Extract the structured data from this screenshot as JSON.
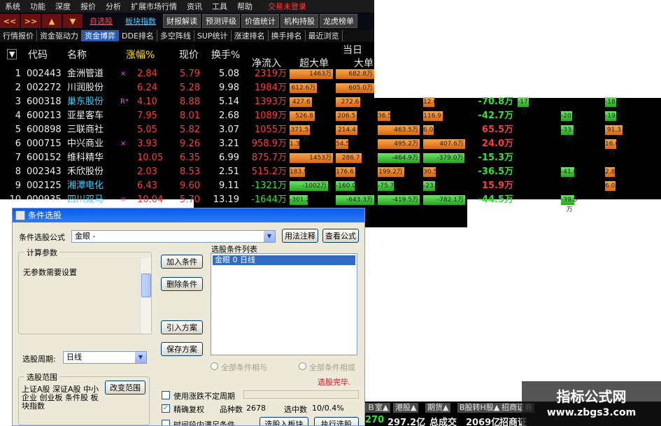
{
  "menubar": {
    "items": [
      "系统",
      "功能",
      "深度",
      "报价",
      "分析",
      "扩展市场行情",
      "资讯",
      "工具",
      "帮助"
    ],
    "trade_login": "交易未登录"
  },
  "toolbar": {
    "nav_buttons": [
      "<<",
      ">>"
    ],
    "link_buttons": [
      "自选股",
      "板块指数"
    ],
    "gray_buttons": [
      "财报解读",
      "预测评级",
      "价值统计",
      "机构持股",
      "龙虎榜单"
    ]
  },
  "subtabs": {
    "items": [
      "行情报价",
      "资金驱动力",
      "资金博弈",
      "DDE排名",
      "多空阵线",
      "SUP统计",
      "涨速排名",
      "换手排名",
      "最近浏览"
    ],
    "active": "资金博弈"
  },
  "table": {
    "headers": [
      "代码",
      "名称",
      "涨幅%",
      "现价",
      "换手%",
      "净流入",
      "超大单",
      "大单"
    ],
    "today_label": "当日",
    "rows": [
      {
        "idx": "1",
        "code": "002443",
        "name": "金洲管道",
        "mark": "×",
        "pct": "2.84",
        "price": "5.79",
        "turnover": "5.08",
        "net": "2319万",
        "huge": "1463万",
        "large": "682.8万"
      },
      {
        "idx": "2",
        "code": "002272",
        "name": "川润股份",
        "mark": "",
        "pct": "6.24",
        "price": "5.28",
        "turnover": "9.98",
        "net": "1984万",
        "huge": "612.6万",
        "large": "605.0万"
      },
      {
        "idx": "3",
        "code": "600318",
        "name": "巢东股份",
        "mark": "R*",
        "pct": "4.10",
        "price": "8.88",
        "turnover": "5.14",
        "net": "1393万",
        "huge": "427.6万",
        "large": "272.6万"
      },
      {
        "idx": "4",
        "code": "600213",
        "name": "亚星客车",
        "mark": "",
        "pct": "7.95",
        "price": "8.01",
        "turnover": "2.68",
        "net": "1089万",
        "huge": "526.8万",
        "large": "206.5万"
      },
      {
        "idx": "5",
        "code": "600898",
        "name": "三联商社",
        "mark": "",
        "pct": "5.05",
        "price": "5.82",
        "turnover": "3.07",
        "net": "1055万",
        "huge": "371.5万",
        "large": "214.4万"
      },
      {
        "idx": "6",
        "code": "000715",
        "name": "中兴商业",
        "mark": "×",
        "pct": "3.93",
        "price": "9.26",
        "turnover": "3.21",
        "net": "958.9万",
        "huge": "1.3万",
        "large": "54.5万"
      },
      {
        "idx": "7",
        "code": "600152",
        "name": "维科精华",
        "mark": "",
        "pct": "10.05",
        "price": "6.35",
        "turnover": "6.99",
        "net": "875.7万",
        "huge": "1453万",
        "large": "286.7万"
      },
      {
        "idx": "8",
        "code": "002343",
        "name": "禾欣股份",
        "mark": "",
        "pct": "2.03",
        "price": "8.53",
        "turnover": "2.51",
        "net": "515.2万",
        "huge": "183.9万",
        "large": "176.6万"
      },
      {
        "idx": "9",
        "code": "002125",
        "name": "湘潭电化",
        "mark": "",
        "pct": "6.43",
        "price": "9.60",
        "turnover": "9.11",
        "net": "-1321万",
        "huge": "-1002万",
        "large": "-160.0万"
      },
      {
        "idx": "10",
        "code": "000935",
        "name": "四川双马",
        "mark": "×",
        "pct": "10.04",
        "price": "5.70",
        "turnover": "13.19",
        "net": "-1644万",
        "huge": "-301.2万",
        "large": "-643.3万"
      }
    ],
    "extra_cols": [
      {
        "c1": "",
        "c2": "12.6万",
        "v1": "-70.8万",
        "v2": "-17.0万",
        "v3": "",
        "v4": "-18.6万"
      },
      {
        "c1": "36.5万",
        "c2": "116.9万",
        "v1": "-42.7万",
        "v2": "",
        "v3": "-20.7万",
        "v4": "-19.8万"
      },
      {
        "c1": "463.5万",
        "c2": "6.0万",
        "v1": "65.5万",
        "v2": "",
        "v3": "-33.1万",
        "v4": "91.3万"
      },
      {
        "c1": "495.2万",
        "c2": "407.6万",
        "v1": "24.0万",
        "v2": "",
        "v3": "",
        "v4": "16.6万"
      },
      {
        "c1": "-464.9万",
        "c2": "-379.0万",
        "v1": "-15.3万",
        "v2": "",
        "v3": "",
        "v4": ""
      },
      {
        "c1": "199.2万",
        "c2": "30.5万",
        "v1": "-36.5万",
        "v2": "",
        "v3": "-41.6万",
        "v4": "2.8万"
      },
      {
        "c1": "-75.7万",
        "c2": "-23.2万",
        "v1": "15.9万",
        "v2": "",
        "v3": "",
        "v4": "6.0万"
      },
      {
        "c1": "-419.5万",
        "c2": "-782.1万",
        "v1": "-44.5万",
        "v2": "",
        "v3": "-39.8万",
        "v4": ""
      }
    ]
  },
  "dialog": {
    "title": "条件选股",
    "formula_label": "条件选股公式",
    "formula_value": "金眼        -",
    "usage_button": "用法注释",
    "view_formula_button": "查看公式",
    "params_group": "计算参数",
    "params_text": "无参数需要设置",
    "add_condition": "加入条件",
    "delete_condition": "删除条件",
    "import_scheme": "引入方案",
    "save_scheme": "保存方案",
    "condition_list_label": "选股条件列表",
    "condition_list": [
      "金眼  0  日线"
    ],
    "period_label": "选股周期:",
    "period_value": "日线",
    "radio_and": "全部条件相与",
    "radio_or": "全部条件相或",
    "status": "选股完毕.",
    "range_group": "选股范围",
    "range_text": "上证A股 深证A股 中小企业 创业板 条件股 板块指数",
    "change_range": "改变范围",
    "use_irregular": "使用涨跌不定周期",
    "precise_restore": "精确复权",
    "count_label": "品种数",
    "count_value": "2678",
    "selected_label": "选中数",
    "selected_value": "10/0.4%",
    "time_condition": "时间段内满足条件",
    "select_into_block": "选股入板块",
    "execute": "执行选股"
  },
  "statusbar": {
    "tabs": [
      "Ｂ室▲",
      "港股▲",
      "期货▲",
      "B股转H股▲",
      "招商证券"
    ],
    "line": [
      "270",
      "297.2亿",
      "总成交",
      "2069亿",
      "招商证"
    ]
  },
  "watermark": {
    "title": "指标公式网",
    "url": "www.zbgs3.com"
  },
  "colors": {
    "up": "#ff3b3b",
    "down": "#2ee82e",
    "bar_orange": "#e8801e",
    "bar_green": "#30b028",
    "dialog_bg": "#ece9d8",
    "title_blue": "#0a5ae8"
  }
}
